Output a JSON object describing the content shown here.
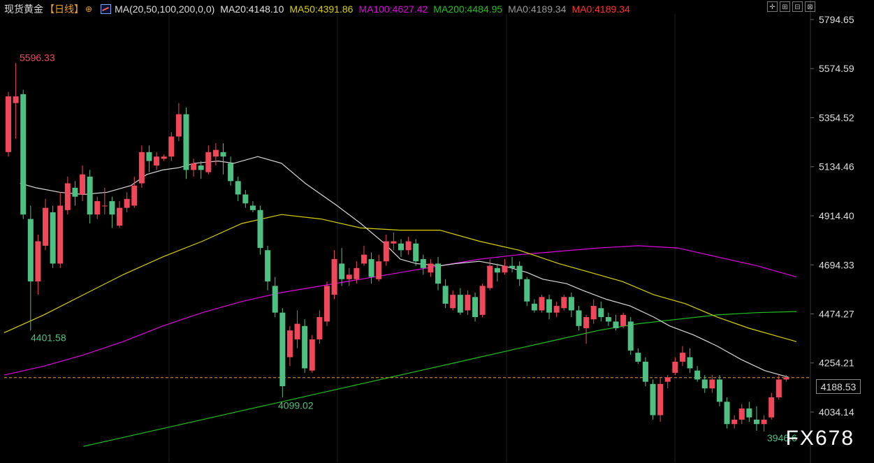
{
  "header": {
    "instrument": "现货黄金",
    "period": "【日线】",
    "plus_icon": "⊕",
    "ma_label": "MA(20,50,100,200,0,0)",
    "ma20": "MA20:4148.10",
    "ma50": "MA50:4391.86",
    "ma100": "MA100:4627.42",
    "ma200": "MA200:4484.95",
    "ma0a": "MA0:4189.34",
    "ma0b": "MA0:4189.34"
  },
  "colors": {
    "up": "#f0475a",
    "down": "#4fc083",
    "ma20": "#d8d8d8",
    "ma50": "#d8d000",
    "ma100": "#e000e0",
    "ma200": "#20c020",
    "ma0a": "#9a9a9a",
    "ma0b": "#ff3030",
    "axis_text": "#dddddd",
    "last_line": "#e8a020"
  },
  "toolbar_icons": [
    "crosshair-icon",
    "layout-icon",
    "indicator-icon",
    "grid-icon"
  ],
  "chart_data": {
    "type": "candlestick",
    "y_ticks": [
      "5794.65",
      "5574.59",
      "5354.52",
      "5134.46",
      "4914.40",
      "4694.33",
      "4474.27",
      "4254.21",
      "4034.14"
    ],
    "ylim": [
      3860,
      5850
    ],
    "last_price": "4188.53",
    "annotations": {
      "high": "5596.33",
      "low1": "4401.58",
      "low2": "4099.02",
      "low3": "3946.6"
    },
    "watermark": "FX678",
    "candles": [
      [
        5200,
        5450,
        5180,
        5470
      ],
      [
        5420,
        5450,
        5260,
        5600
      ],
      [
        5460,
        4920,
        4900,
        5480
      ],
      [
        4900,
        4620,
        4400,
        4960
      ],
      [
        4620,
        4800,
        4560,
        4830
      ],
      [
        4780,
        4950,
        4760,
        4990
      ],
      [
        4930,
        4700,
        4680,
        4960
      ],
      [
        4700,
        4960,
        4680,
        5020
      ],
      [
        4940,
        5060,
        4920,
        5090
      ],
      [
        5040,
        5000,
        4960,
        5070
      ],
      [
        5010,
        5100,
        4980,
        5140
      ],
      [
        5090,
        4920,
        4880,
        5120
      ],
      [
        4920,
        4980,
        4900,
        5000
      ],
      [
        4960,
        4960,
        4920,
        5040
      ],
      [
        4980,
        4920,
        4860,
        5000
      ],
      [
        4870,
        4950,
        4860,
        4980
      ],
      [
        4950,
        4990,
        4930,
        5020
      ],
      [
        4960,
        5050,
        4950,
        5090
      ],
      [
        5060,
        5200,
        5040,
        5230
      ],
      [
        5200,
        5160,
        5110,
        5230
      ],
      [
        5140,
        5180,
        5120,
        5200
      ],
      [
        5170,
        5180,
        5160,
        5190
      ],
      [
        5180,
        5270,
        5160,
        5290
      ],
      [
        5270,
        5370,
        5250,
        5420
      ],
      [
        5370,
        5120,
        5080,
        5400
      ],
      [
        5120,
        5150,
        5090,
        5170
      ],
      [
        5140,
        5120,
        5080,
        5160
      ],
      [
        5110,
        5200,
        5100,
        5230
      ],
      [
        5180,
        5210,
        5140,
        5240
      ],
      [
        5200,
        5180,
        5100,
        5240
      ],
      [
        5150,
        5070,
        5050,
        5180
      ],
      [
        5070,
        5010,
        4980,
        5090
      ],
      [
        5010,
        4970,
        4950,
        5030
      ],
      [
        4960,
        4940,
        4930,
        4980
      ],
      [
        4940,
        4770,
        4740,
        4960
      ],
      [
        4760,
        4620,
        4580,
        4780
      ],
      [
        4600,
        4480,
        4460,
        4640
      ],
      [
        4480,
        4150,
        4100,
        4500
      ],
      [
        4280,
        4400,
        4240,
        4420
      ],
      [
        4360,
        4430,
        4320,
        4490
      ],
      [
        4420,
        4230,
        4210,
        4450
      ],
      [
        4220,
        4360,
        4210,
        4380
      ],
      [
        4360,
        4460,
        4340,
        4490
      ],
      [
        4440,
        4600,
        4420,
        4620
      ],
      [
        4560,
        4720,
        4540,
        4760
      ],
      [
        4700,
        4630,
        4600,
        4770
      ],
      [
        4630,
        4650,
        4600,
        4680
      ],
      [
        4630,
        4680,
        4610,
        4710
      ],
      [
        4700,
        4740,
        4690,
        4780
      ],
      [
        4720,
        4640,
        4610,
        4750
      ],
      [
        4630,
        4710,
        4620,
        4740
      ],
      [
        4710,
        4800,
        4690,
        4830
      ],
      [
        4790,
        4800,
        4760,
        4840
      ],
      [
        4790,
        4760,
        4730,
        4810
      ],
      [
        4760,
        4800,
        4740,
        4820
      ],
      [
        4790,
        4710,
        4690,
        4810
      ],
      [
        4720,
        4680,
        4650,
        4740
      ],
      [
        4660,
        4700,
        4640,
        4720
      ],
      [
        4700,
        4610,
        4580,
        4730
      ],
      [
        4600,
        4520,
        4500,
        4630
      ],
      [
        4500,
        4560,
        4490,
        4580
      ],
      [
        4560,
        4480,
        4470,
        4590
      ],
      [
        4490,
        4560,
        4470,
        4580
      ],
      [
        4550,
        4460,
        4440,
        4570
      ],
      [
        4470,
        4600,
        4460,
        4610
      ],
      [
        4590,
        4690,
        4580,
        4720
      ],
      [
        4680,
        4660,
        4620,
        4700
      ],
      [
        4660,
        4690,
        4650,
        4720
      ],
      [
        4690,
        4680,
        4660,
        4730
      ],
      [
        4690,
        4630,
        4600,
        4710
      ],
      [
        4630,
        4530,
        4510,
        4640
      ],
      [
        4520,
        4490,
        4480,
        4540
      ],
      [
        4490,
        4550,
        4480,
        4560
      ],
      [
        4540,
        4480,
        4450,
        4560
      ],
      [
        4480,
        4510,
        4460,
        4530
      ],
      [
        4500,
        4550,
        4490,
        4560
      ],
      [
        4550,
        4490,
        4460,
        4570
      ],
      [
        4490,
        4420,
        4400,
        4510
      ],
      [
        4410,
        4460,
        4340,
        4470
      ],
      [
        4450,
        4510,
        4430,
        4540
      ],
      [
        4500,
        4460,
        4440,
        4530
      ],
      [
        4460,
        4440,
        4420,
        4480
      ],
      [
        4440,
        4410,
        4400,
        4470
      ],
      [
        4420,
        4470,
        4410,
        4480
      ],
      [
        4440,
        4310,
        4290,
        4460
      ],
      [
        4300,
        4260,
        4250,
        4320
      ],
      [
        4260,
        4170,
        4150,
        4280
      ],
      [
        4160,
        4020,
        4000,
        4180
      ],
      [
        4020,
        4160,
        3990,
        4190
      ],
      [
        4170,
        4190,
        4140,
        4200
      ],
      [
        4210,
        4260,
        4200,
        4280
      ],
      [
        4260,
        4300,
        4240,
        4330
      ],
      [
        4280,
        4230,
        4210,
        4320
      ],
      [
        4220,
        4180,
        4170,
        4240
      ],
      [
        4180,
        4140,
        4120,
        4200
      ],
      [
        4140,
        4180,
        4120,
        4200
      ],
      [
        4180,
        4080,
        4060,
        4200
      ],
      [
        4080,
        3980,
        3960,
        4100
      ],
      [
        3980,
        4000,
        3960,
        4020
      ],
      [
        4000,
        4050,
        3980,
        4070
      ],
      [
        4050,
        4010,
        3990,
        4080
      ],
      [
        4000,
        3980,
        3950,
        4060
      ],
      [
        3980,
        4000,
        3946.6,
        4020
      ],
      [
        4010,
        4100,
        4000,
        4120
      ],
      [
        4100,
        4180,
        4090,
        4200
      ],
      [
        4180,
        4190,
        4170,
        4200
      ]
    ],
    "ma20": [
      [
        0.02,
        5060
      ],
      [
        0.04,
        5040
      ],
      [
        0.07,
        5020
      ],
      [
        0.1,
        5010
      ],
      [
        0.13,
        5020
      ],
      [
        0.16,
        5050
      ],
      [
        0.18,
        5100
      ],
      [
        0.2,
        5120
      ],
      [
        0.22,
        5130
      ],
      [
        0.24,
        5150
      ],
      [
        0.27,
        5160
      ],
      [
        0.29,
        5150
      ],
      [
        0.32,
        5180
      ],
      [
        0.35,
        5150
      ],
      [
        0.38,
        5060
      ],
      [
        0.42,
        4960
      ],
      [
        0.45,
        4880
      ],
      [
        0.48,
        4790
      ],
      [
        0.5,
        4720
      ],
      [
        0.52,
        4700
      ],
      [
        0.55,
        4690
      ],
      [
        0.57,
        4700
      ],
      [
        0.6,
        4710
      ],
      [
        0.63,
        4690
      ],
      [
        0.66,
        4660
      ],
      [
        0.68,
        4630
      ],
      [
        0.71,
        4610
      ],
      [
        0.73,
        4580
      ],
      [
        0.76,
        4540
      ],
      [
        0.79,
        4510
      ],
      [
        0.82,
        4460
      ],
      [
        0.84,
        4420
      ],
      [
        0.87,
        4380
      ],
      [
        0.9,
        4330
      ],
      [
        0.93,
        4270
      ],
      [
        0.96,
        4220
      ],
      [
        0.99,
        4190
      ]
    ],
    "ma50": [
      [
        0.0,
        4390
      ],
      [
        0.05,
        4470
      ],
      [
        0.1,
        4560
      ],
      [
        0.15,
        4650
      ],
      [
        0.2,
        4730
      ],
      [
        0.25,
        4800
      ],
      [
        0.3,
        4880
      ],
      [
        0.35,
        4920
      ],
      [
        0.4,
        4900
      ],
      [
        0.45,
        4860
      ],
      [
        0.5,
        4850
      ],
      [
        0.55,
        4850
      ],
      [
        0.6,
        4800
      ],
      [
        0.65,
        4760
      ],
      [
        0.7,
        4700
      ],
      [
        0.74,
        4660
      ],
      [
        0.78,
        4620
      ],
      [
        0.82,
        4560
      ],
      [
        0.86,
        4520
      ],
      [
        0.9,
        4460
      ],
      [
        0.94,
        4410
      ],
      [
        0.98,
        4370
      ],
      [
        1.0,
        4350
      ]
    ],
    "ma100": [
      [
        0.0,
        4200
      ],
      [
        0.05,
        4240
      ],
      [
        0.1,
        4290
      ],
      [
        0.15,
        4350
      ],
      [
        0.2,
        4420
      ],
      [
        0.25,
        4480
      ],
      [
        0.3,
        4530
      ],
      [
        0.35,
        4570
      ],
      [
        0.4,
        4600
      ],
      [
        0.45,
        4630
      ],
      [
        0.5,
        4660
      ],
      [
        0.55,
        4690
      ],
      [
        0.6,
        4720
      ],
      [
        0.65,
        4740
      ],
      [
        0.7,
        4755
      ],
      [
        0.75,
        4770
      ],
      [
        0.8,
        4780
      ],
      [
        0.85,
        4770
      ],
      [
        0.9,
        4730
      ],
      [
        0.95,
        4690
      ],
      [
        1.0,
        4640
      ]
    ],
    "ma200": [
      [
        0.1,
        3880
      ],
      [
        0.15,
        3920
      ],
      [
        0.2,
        3960
      ],
      [
        0.25,
        4000
      ],
      [
        0.3,
        4040
      ],
      [
        0.35,
        4080
      ],
      [
        0.4,
        4120
      ],
      [
        0.45,
        4160
      ],
      [
        0.5,
        4200
      ],
      [
        0.55,
        4240
      ],
      [
        0.6,
        4280
      ],
      [
        0.65,
        4320
      ],
      [
        0.7,
        4360
      ],
      [
        0.75,
        4400
      ],
      [
        0.8,
        4430
      ],
      [
        0.85,
        4450
      ],
      [
        0.9,
        4470
      ],
      [
        0.95,
        4480
      ],
      [
        1.0,
        4485
      ]
    ]
  }
}
